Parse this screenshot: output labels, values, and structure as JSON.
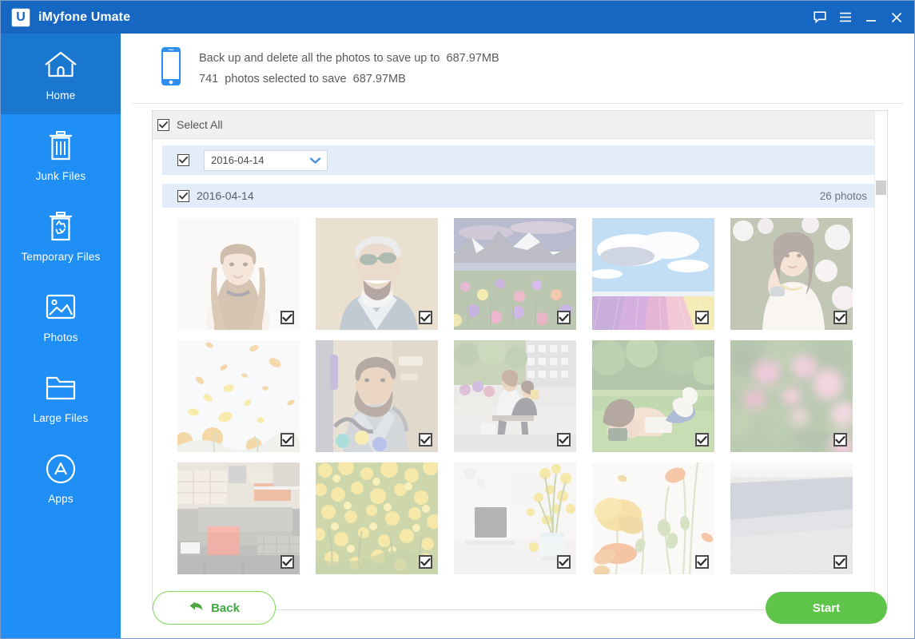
{
  "window": {
    "title": "iMyfone Umate",
    "logo_letter": "U",
    "controls": [
      {
        "name": "feedback-icon",
        "label": "Feedback"
      },
      {
        "name": "menu-icon",
        "label": "Menu"
      },
      {
        "name": "minimize-icon",
        "label": "Minimize"
      },
      {
        "name": "close-icon",
        "label": "Close"
      }
    ],
    "titlebar_color": "#1667c2"
  },
  "sidebar": {
    "background_color": "#1f8ff5",
    "active_color": "#1a77cf",
    "items": [
      {
        "label": "Home",
        "icon": "home-icon",
        "active": true
      },
      {
        "label": "Junk Files",
        "icon": "trash-icon",
        "active": false
      },
      {
        "label": "Temporary Files",
        "icon": "recycle-bin-icon",
        "active": false
      },
      {
        "label": "Photos",
        "icon": "photo-icon",
        "active": false
      },
      {
        "label": "Large Files",
        "icon": "folder-icon",
        "active": false
      },
      {
        "label": "Apps",
        "icon": "apps-icon",
        "active": false
      }
    ]
  },
  "banner": {
    "icon": "iphone-icon",
    "line1": "Back up and delete all the photos to save up to  687.97MB",
    "line2": "741  photos selected to save  687.97MB",
    "save_size": "687.97MB",
    "photo_count": "741"
  },
  "panel": {
    "select_all_label": "Select All",
    "select_all_checked": true,
    "date_filter": {
      "value": "2016-04-14",
      "checked": true,
      "caret": "chevron-down-icon"
    },
    "group": {
      "title": "2016-04-14",
      "checked": true,
      "count_label": "26 photos"
    },
    "photos": [
      {
        "alt": "woman-with-long-hair-portrait",
        "checked": true
      },
      {
        "alt": "laughing-man-with-sunglasses",
        "checked": true
      },
      {
        "alt": "mountain-lake-and-wildflowers",
        "checked": true
      },
      {
        "alt": "tulip-field-under-clouds",
        "checked": true
      },
      {
        "alt": "woman-among-white-blossoms",
        "checked": true
      },
      {
        "alt": "falling-yellow-petals",
        "checked": true
      },
      {
        "alt": "bearded-man-indoors",
        "checked": true
      },
      {
        "alt": "mother-and-child-on-street-bench",
        "checked": true
      },
      {
        "alt": "woman-reading-on-grass",
        "checked": true
      },
      {
        "alt": "pink-blossoms-bokeh",
        "checked": true
      },
      {
        "alt": "office-lounge-with-red-stool",
        "checked": true
      },
      {
        "alt": "yellow-rapeseed-flowers",
        "checked": true
      },
      {
        "alt": "laptop-and-flower-vase-on-desk",
        "checked": true
      },
      {
        "alt": "orange-poppies-on-white",
        "checked": true
      },
      {
        "alt": "sand-and-gravel-texture",
        "checked": true
      }
    ],
    "scrollbar": {
      "name": "vertical-scrollbar",
      "position_percent": 14
    }
  },
  "footer": {
    "back_label": "Back",
    "back_icon": "back-arrow-icon",
    "start_label": "Start",
    "back_color": "#3fa83f",
    "start_color": "#5ec44a"
  }
}
